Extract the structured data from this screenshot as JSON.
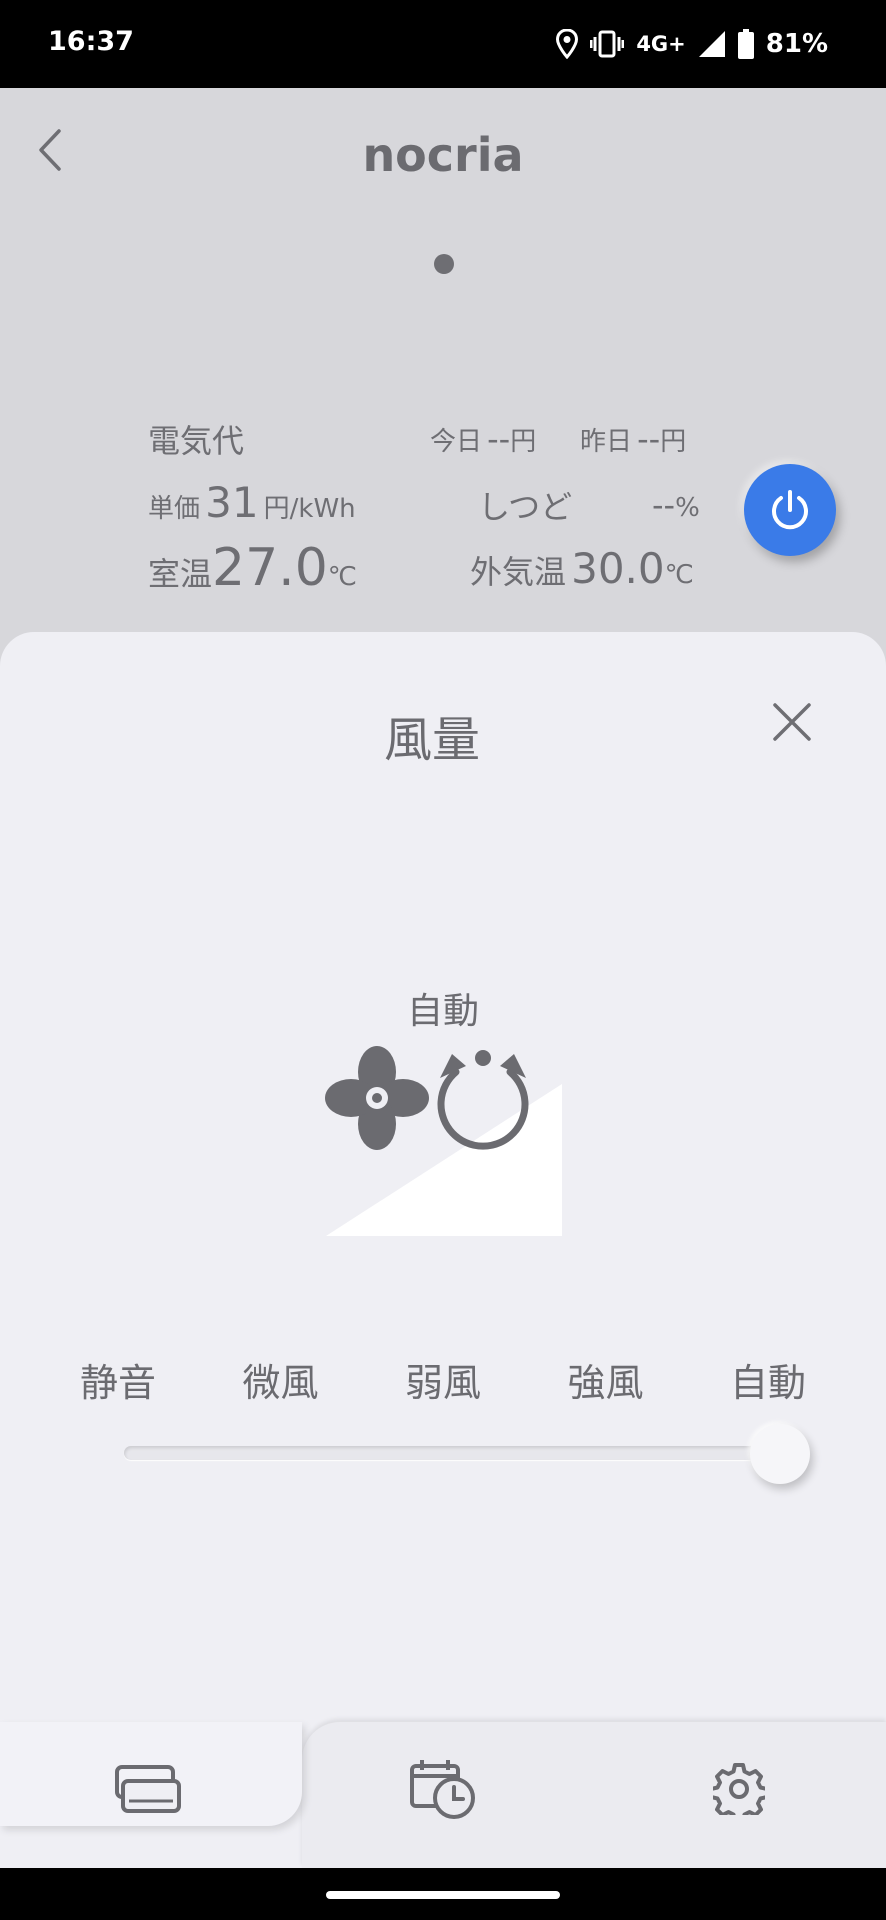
{
  "status_bar": {
    "time": "16:37",
    "network": "4G+",
    "battery": "81%"
  },
  "header": {
    "title": "nocria"
  },
  "info": {
    "electricity_label": "電気代",
    "today_label": "今日",
    "today_value": "--",
    "today_unit": "円",
    "yesterday_label": "昨日",
    "yesterday_value": "--",
    "yesterday_unit": "円",
    "unit_price_label": "単価",
    "unit_price_value": "31",
    "unit_price_unit": "円/kWh",
    "humidity_label": "しつど",
    "humidity_value": "--",
    "humidity_unit": "%",
    "room_temp_label": "室温",
    "room_temp_value": "27.0",
    "room_temp_unit": "℃",
    "outdoor_temp_label": "外気温",
    "outdoor_temp_value": "30.0",
    "outdoor_temp_unit": "℃"
  },
  "sheet": {
    "title": "風量",
    "current_mode": "自動",
    "levels": [
      "静音",
      "微風",
      "弱風",
      "強風",
      "自動"
    ],
    "slider_value": 1.0
  },
  "colors": {
    "accent": "#3a7be8",
    "background": "#d7d7db",
    "sheet": "#efeff4",
    "text": "#6e6e73"
  },
  "icons": {
    "back": "chevron-left-icon",
    "close": "close-icon",
    "power": "power-icon",
    "mode": "fan-auto-icon",
    "nav_1": "aircon-icon",
    "nav_2": "timer-icon",
    "nav_3": "gear-icon"
  }
}
